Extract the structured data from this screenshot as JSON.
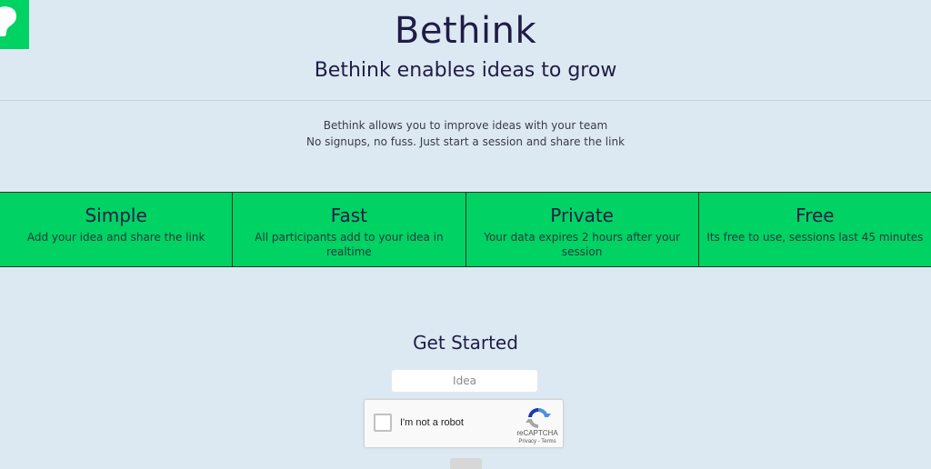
{
  "header": {
    "title": "Bethink",
    "subtitle": "Bethink enables ideas to grow"
  },
  "description": {
    "line1": "Bethink allows you to improve ideas with your team",
    "line2": "No signups, no fuss. Just start a session and share the link"
  },
  "features": [
    {
      "title": "Simple",
      "text": "Add your idea and share the link"
    },
    {
      "title": "Fast",
      "text": "All participants add to your idea in realtime"
    },
    {
      "title": "Private",
      "text": "Your data expires 2 hours after your session"
    },
    {
      "title": "Free",
      "text": "Its free to use, sessions last 45 minutes"
    }
  ],
  "get_started": {
    "heading": "Get Started",
    "idea_placeholder": "Idea",
    "idea_value": ""
  },
  "captcha": {
    "label": "I'm not a robot",
    "brand": "reCAPTCHA",
    "links": "Privacy - Terms",
    "checked": false
  },
  "colors": {
    "background": "#dde9f2",
    "accent": "#00d264",
    "text": "#1f1d47"
  },
  "icons": {
    "logo": "bethink-logo-icon",
    "recaptcha": "recaptcha-icon"
  }
}
